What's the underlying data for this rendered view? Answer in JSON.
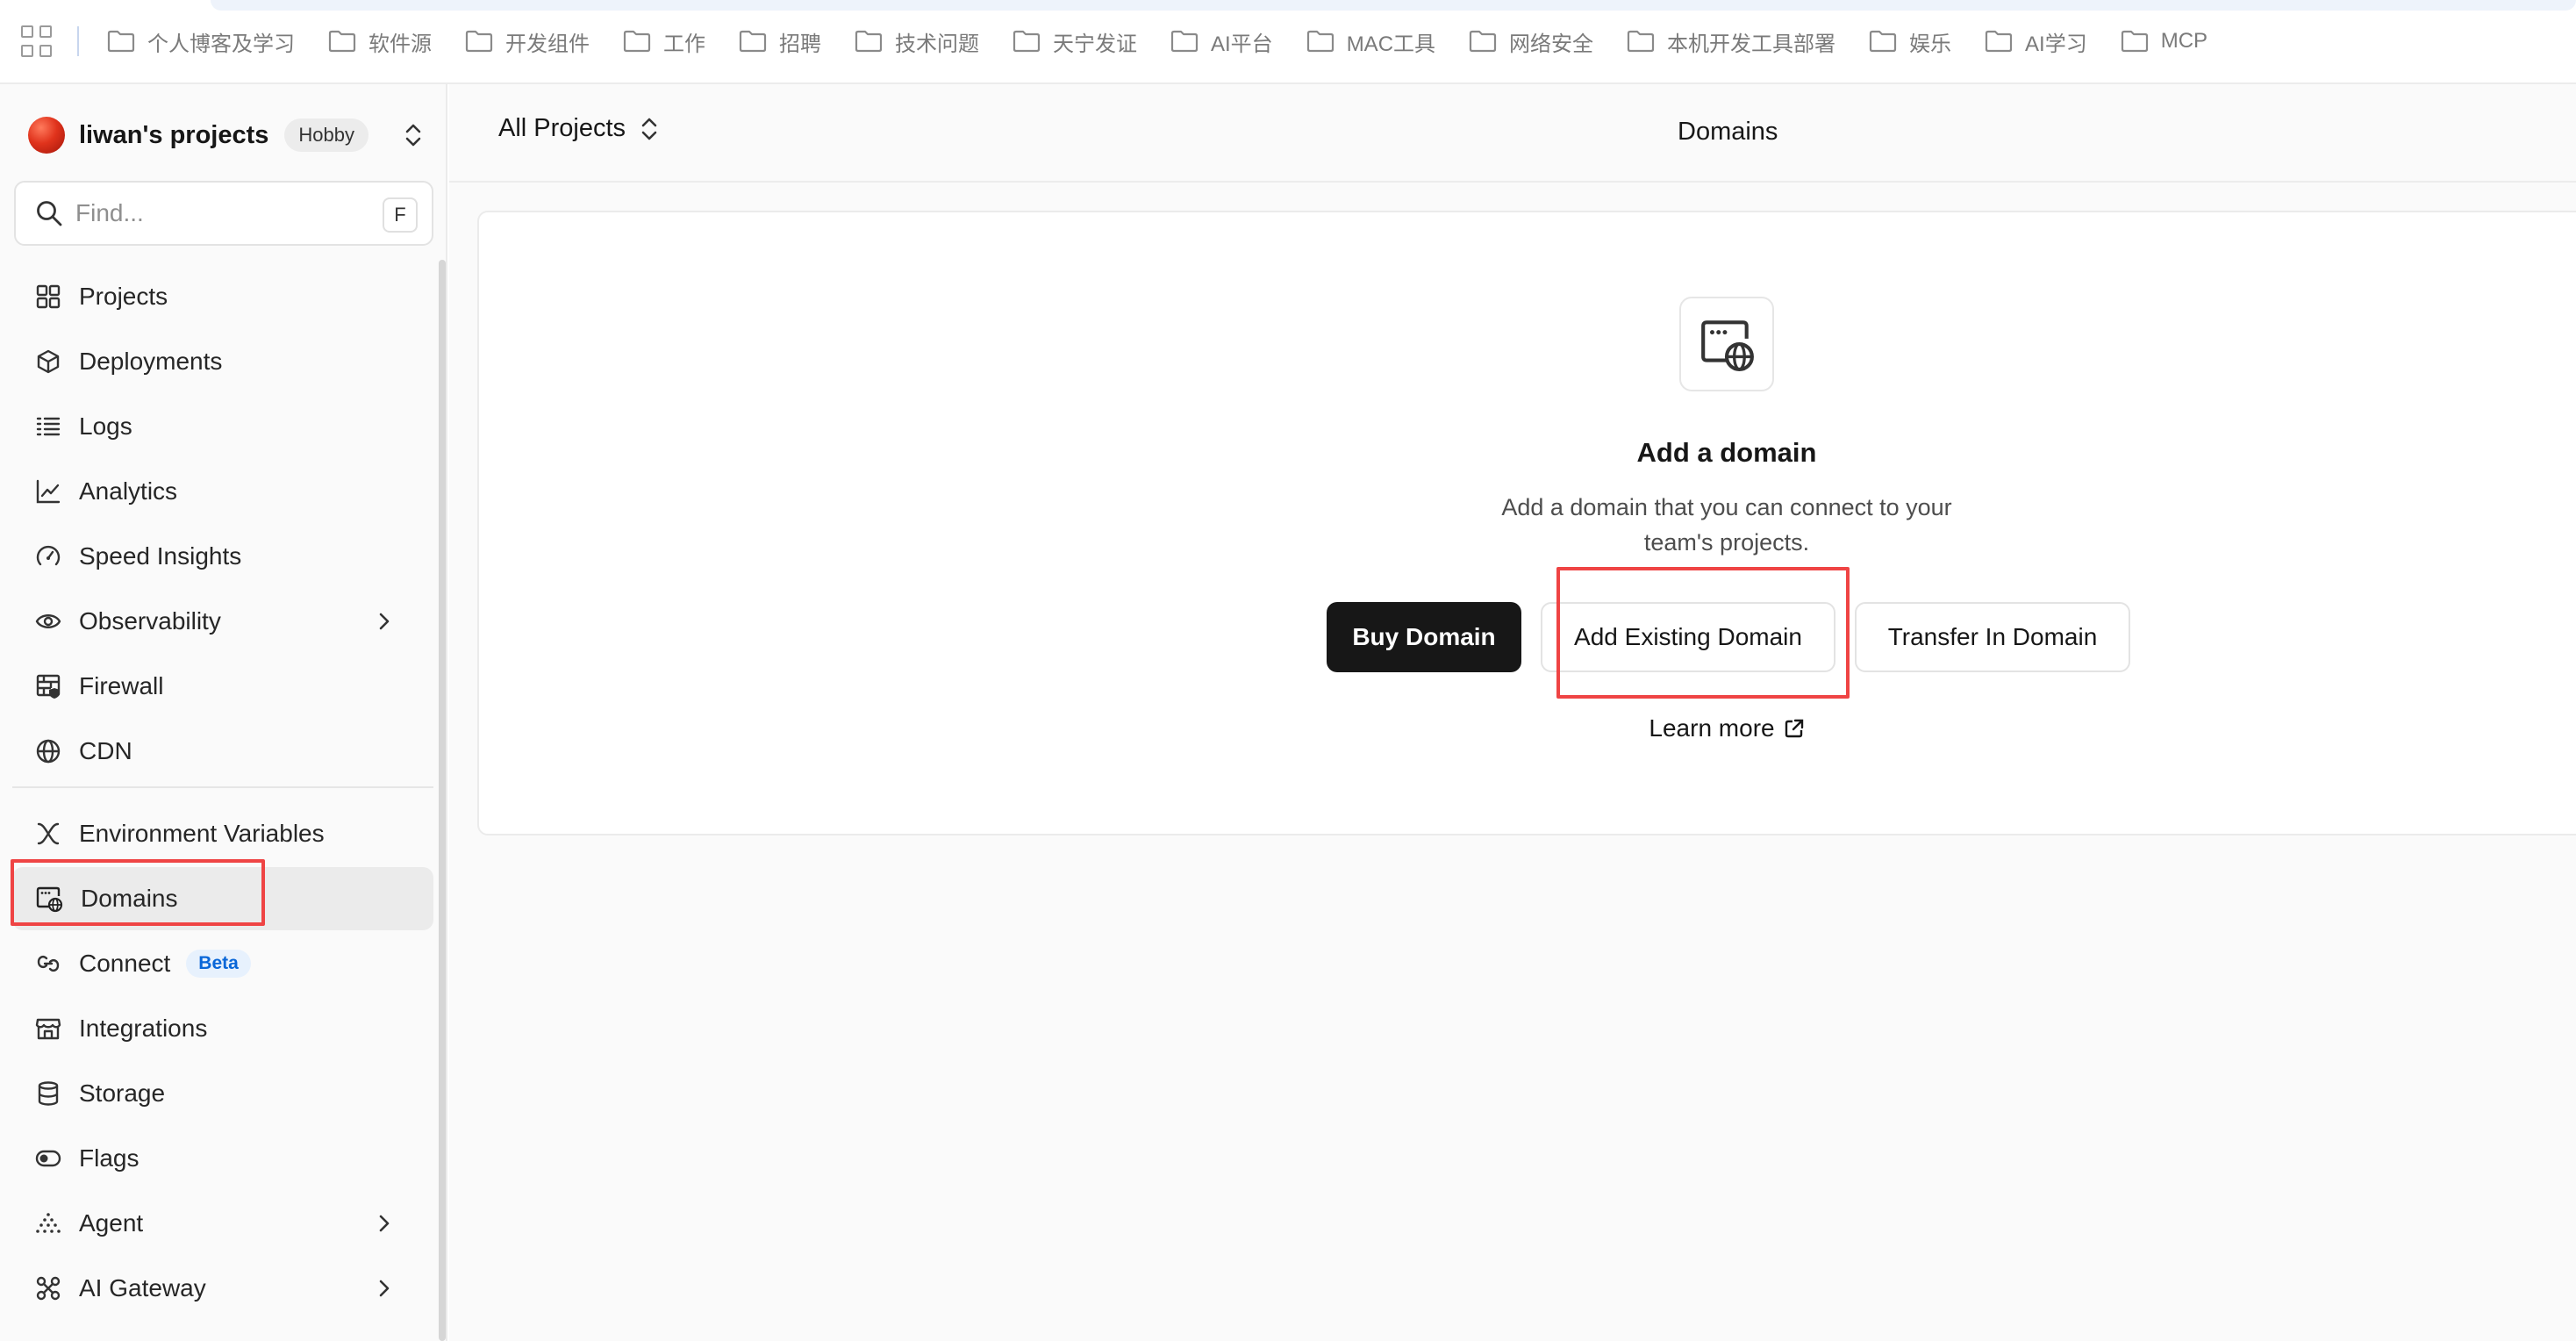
{
  "bookmarks": [
    {
      "label": "个人博客及学习"
    },
    {
      "label": "软件源"
    },
    {
      "label": "开发组件"
    },
    {
      "label": "工作"
    },
    {
      "label": "招聘"
    },
    {
      "label": "技术问题"
    },
    {
      "label": "天宁发证"
    },
    {
      "label": "AI平台"
    },
    {
      "label": "MAC工具"
    },
    {
      "label": "网络安全"
    },
    {
      "label": "本机开发工具部署"
    },
    {
      "label": "娱乐"
    },
    {
      "label": "AI学习"
    },
    {
      "label": "MCP"
    }
  ],
  "team": {
    "name": "liwan's projects",
    "plan": "Hobby"
  },
  "search": {
    "placeholder": "Find...",
    "shortcut": "F"
  },
  "nav": {
    "projects": "Projects",
    "deployments": "Deployments",
    "logs": "Logs",
    "analytics": "Analytics",
    "speed_insights": "Speed Insights",
    "observability": "Observability",
    "firewall": "Firewall",
    "cdn": "CDN",
    "env_vars": "Environment Variables",
    "domains": "Domains",
    "connect": "Connect",
    "connect_badge": "Beta",
    "integrations": "Integrations",
    "storage": "Storage",
    "flags": "Flags",
    "agent": "Agent",
    "ai_gateway": "AI Gateway"
  },
  "header": {
    "project_selector": "All Projects",
    "title": "Domains"
  },
  "empty_state": {
    "title": "Add a domain",
    "description": "Add a domain that you can connect to your team's projects.",
    "buy_label": "Buy Domain",
    "add_existing_label": "Add Existing Domain",
    "transfer_label": "Transfer In Domain",
    "learn_more_label": "Learn more"
  },
  "colors": {
    "primary_button": "#171717",
    "highlight": "#ef4444",
    "beta_badge": "#0a67d8"
  }
}
